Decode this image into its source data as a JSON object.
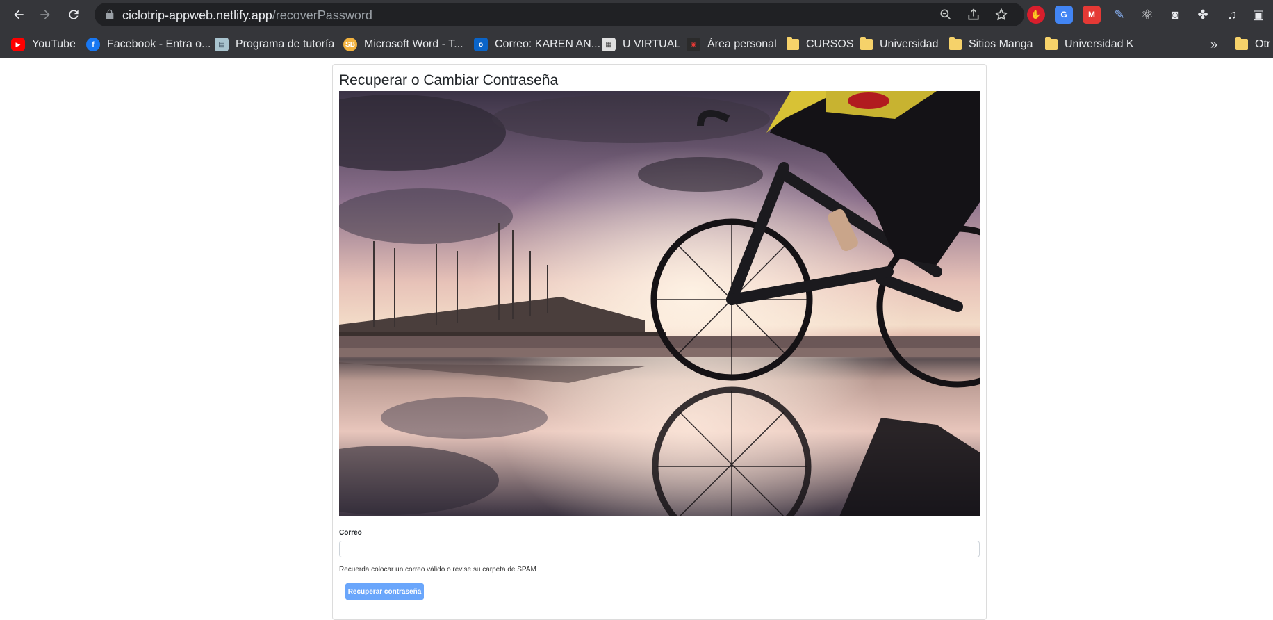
{
  "browser": {
    "url_host": "ciclotrip-appweb.netlify.app",
    "url_path": "/recoverPassword",
    "bookmarks": [
      {
        "label": "YouTube",
        "icon": "youtube-icon",
        "color": "#ff0000"
      },
      {
        "label": "Facebook - Entra o...",
        "icon": "facebook-icon",
        "color": "#1877f2"
      },
      {
        "label": "Programa de tutoría",
        "icon": "tutoria-icon",
        "color": "#6b8e9e"
      },
      {
        "label": "Microsoft Word - T...",
        "icon": "word-icon",
        "color": "#f2b23e",
        "glyph": "SB"
      },
      {
        "label": "Correo: KAREN AN...",
        "icon": "outlook-icon",
        "color": "#0a64c8",
        "glyph": "o"
      },
      {
        "label": "U VIRTUAL",
        "icon": "uvirtual-icon",
        "color": "#cfcfcf"
      },
      {
        "label": "Área personal",
        "icon": "area-personal-icon",
        "color": "#b01f24"
      },
      {
        "label": "CURSOS",
        "icon": "folder-icon"
      },
      {
        "label": "Universidad",
        "icon": "folder-icon"
      },
      {
        "label": "Sitios Manga",
        "icon": "folder-icon"
      },
      {
        "label": "Universidad K",
        "icon": "folder-icon"
      }
    ],
    "overflow": "»",
    "other_bookmarks": "Otr"
  },
  "page": {
    "title": "Recuperar o Cambiar Contraseña",
    "hero_image": "cyclist-sunset-reflection-image",
    "email_label": "Correo",
    "email_value": "",
    "email_placeholder": "",
    "help_text": "Recuerda colocar un correo válido o revise su carpeta de SPAM",
    "submit_label": "Recuperar contraseña"
  },
  "colors": {
    "chrome_bg": "#35363a",
    "omnibox_bg": "#202124",
    "button_bg": "#6aa6fb"
  }
}
